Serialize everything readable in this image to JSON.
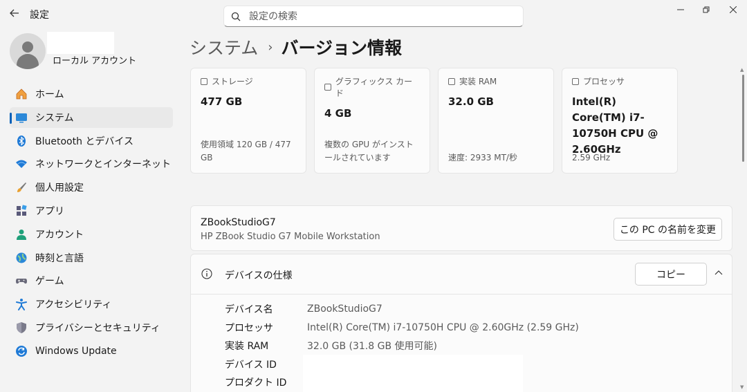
{
  "app": {
    "title": "設定"
  },
  "search": {
    "placeholder": "設定の検索"
  },
  "profile": {
    "account_type": "ローカル アカウント"
  },
  "nav": {
    "items": [
      {
        "label": "ホーム",
        "icon": "home-icon"
      },
      {
        "label": "システム",
        "icon": "system-icon",
        "active": true
      },
      {
        "label": "Bluetooth とデバイス",
        "icon": "bluetooth-icon"
      },
      {
        "label": "ネットワークとインターネット",
        "icon": "wifi-icon"
      },
      {
        "label": "個人用設定",
        "icon": "brush-icon"
      },
      {
        "label": "アプリ",
        "icon": "apps-icon"
      },
      {
        "label": "アカウント",
        "icon": "account-icon"
      },
      {
        "label": "時刻と言語",
        "icon": "time-language-icon"
      },
      {
        "label": "ゲーム",
        "icon": "gamepad-icon"
      },
      {
        "label": "アクセシビリティ",
        "icon": "accessibility-icon"
      },
      {
        "label": "プライバシーとセキュリティ",
        "icon": "shield-icon"
      },
      {
        "label": "Windows Update",
        "icon": "update-icon"
      }
    ]
  },
  "breadcrumb": {
    "parent": "システム",
    "separator": "›",
    "current": "バージョン情報"
  },
  "cards": [
    {
      "label": "ストレージ",
      "value": "477 GB",
      "detail": "使用領域 120 GB / 477 GB"
    },
    {
      "label": "グラフィックス カード",
      "value": "4 GB",
      "detail": "複数の GPU がインストールされています"
    },
    {
      "label": "実装 RAM",
      "value": "32.0 GB",
      "detail": "速度: 2933 MT/秒"
    },
    {
      "label": "プロセッサ",
      "value": "Intel(R) Core(TM) i7-10750H CPU @ 2.60GHz",
      "detail": "2.59 GHz"
    }
  ],
  "device": {
    "name": "ZBookStudioG7",
    "model": "HP ZBook Studio G7 Mobile Workstation",
    "rename_label": "この PC の名前を変更"
  },
  "specs": {
    "title": "デバイスの仕様",
    "copy_label": "コピー",
    "rows": [
      {
        "key": "デバイス名",
        "value": "ZBookStudioG7"
      },
      {
        "key": "プロセッサ",
        "value": "Intel(R) Core(TM) i7-10750H CPU @ 2.60GHz (2.59 GHz)"
      },
      {
        "key": "実装 RAM",
        "value": "32.0 GB (31.8 GB 使用可能)"
      },
      {
        "key": "デバイス ID",
        "value": ""
      },
      {
        "key": "プロダクト ID",
        "value": ""
      }
    ]
  },
  "colors": {
    "accent": "#005fb8",
    "background": "#f3f3f3",
    "card": "#fbfbfb"
  }
}
